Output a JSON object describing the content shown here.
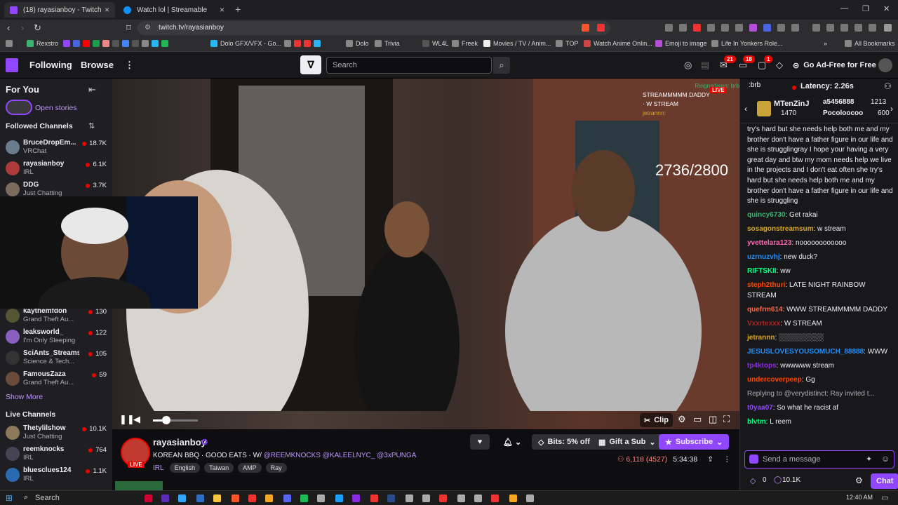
{
  "browser": {
    "tabs": [
      {
        "label": "(18) rayasianboy - Twitch",
        "active": true
      },
      {
        "label": "Watch lol | Streamable",
        "active": false
      }
    ],
    "url": "twitch.tv/rayasianboy",
    "bookmarks": [
      "Rexstro",
      "Dolo GFX/VFX - Go...",
      "Dolo",
      "Trivia",
      "WL4L",
      "Freek",
      "Movies / TV / Anim...",
      "TOP",
      "Watch Anime Onlin...",
      "Emoji to image",
      "Life In Yonkers Role..."
    ],
    "all_bookmarks": "All Bookmarks"
  },
  "twitch_top": {
    "following": "Following",
    "browse": "Browse",
    "search_placeholder": "Search",
    "badges": [
      "21",
      "18",
      "1"
    ],
    "adfree": "Go Ad-Free for Free"
  },
  "sidebar": {
    "for_you": "For You",
    "open_stories": "Open stories",
    "followed_header": "Followed Channels",
    "followed": [
      {
        "name": "BruceDropEm...",
        "category": "VRChat",
        "viewers": "18.7K"
      },
      {
        "name": "rayasianboy",
        "category": "IRL",
        "viewers": "6.1K"
      },
      {
        "name": "DDG",
        "category": "Just Chatting",
        "viewers": "3.7K"
      },
      {
        "name": "kaythemfdon",
        "category": "Grand Theft Au...",
        "viewers": "130"
      },
      {
        "name": "leaksworld_",
        "category": "I'm Only Sleeping",
        "viewers": "122"
      },
      {
        "name": "SciAnts_Streams",
        "category": "Science & Tech...",
        "viewers": "105"
      },
      {
        "name": "FamousZaza",
        "category": "Grand Theft Au...",
        "viewers": "59"
      }
    ],
    "show_more": "Show More",
    "live_header": "Live Channels",
    "live": [
      {
        "name": "Thetylilshow",
        "category": "Just Chatting",
        "viewers": "10.1K"
      },
      {
        "name": "reemknocks",
        "category": "IRL",
        "viewers": "764"
      },
      {
        "name": "bluesclues124",
        "category": "IRL",
        "viewers": "1.1K"
      }
    ]
  },
  "video": {
    "counter": "2736/2800",
    "clip": "Clip",
    "live": "LIVE",
    "seek_fraction": 0.2,
    "overlay_chat": [
      "STREAMMMMM DADDY",
      "· W STREAM",
      "jetrannn:",
      "Reignsdawg: brb"
    ]
  },
  "stream": {
    "channel": "rayasianboy",
    "live_label": "LIVE",
    "title_parts": [
      "KOREAN BBQ",
      "GOOD EATS",
      "W/",
      "@REEMKNOCKS @KALEELNYC_ @3xPUNGA"
    ],
    "category": "IRL",
    "tags": [
      "English",
      "Taiwan",
      "AMP",
      "Ray"
    ],
    "bits": "Bits: 5% off",
    "gift": "Gift a Sub",
    "subscribe": "Subscribe",
    "viewers": "6,118 (4527)",
    "uptime": "5:34:38"
  },
  "chat": {
    "latency": "Latency: 2.26s",
    "hype": [
      {
        "name": "MTenZinJ",
        "value": "1470"
      },
      {
        "name": "a5456888",
        "value": "1213"
      },
      {
        "name": "Pocoloocoo",
        "value": "600"
      }
    ],
    "messages": [
      {
        "user": "",
        "color": "#efeff1",
        "text": "try's hard but she needs help both me and my brother don't have a father figure in our life and she is strugglingray I hope your having a very great day and btw my mom needs help we live in the projects and I don't eat often she try's hard but she needs help both me and my brother don't have a father figure in our life and she is struggling"
      },
      {
        "user": "quincy6730",
        "color": "#3cb371",
        "text": "Get rakai"
      },
      {
        "user": "sosagonstreamsum",
        "color": "#daa520",
        "text": "w stream"
      },
      {
        "user": "yvettelara123",
        "color": "#ff69b4",
        "text": "noooooooooooo"
      },
      {
        "user": "uzrnuzvhj",
        "color": "#1e90ff",
        "text": "new duck?"
      },
      {
        "user": "RIFTSKII",
        "color": "#00ff7f",
        "text": "ww"
      },
      {
        "user": "steph2thuri",
        "color": "#ff4500",
        "text": "LATE NIGHT RAINBOW STREAM"
      },
      {
        "user": "quefrm614",
        "color": "#ff6347",
        "text": "WWW STREAMMMMM DADDY"
      },
      {
        "user": "Vxxrtexxx",
        "color": "#b22222",
        "text": "W STREAM"
      },
      {
        "user": "jetrannn",
        "color": "#daa520",
        "text": "░░░░░░░░░"
      },
      {
        "user": "JESUSLOVESYOUSOMUCH_88888",
        "color": "#1e90ff",
        "text": "WWW"
      },
      {
        "user": "tp4ktops",
        "color": "#8a2be2",
        "text": "wwwwww stream"
      },
      {
        "user": "undercoverpeep",
        "color": "#ff4500",
        "text": "Gg"
      },
      {
        "user": "",
        "color": "#adadb8",
        "text": "Replying to @verydistinct: Ray invited t..."
      },
      {
        "user": "t0yaa07",
        "color": "#9147ff",
        "text": "So what he racist af"
      },
      {
        "user": "blvtm",
        "color": "#00ff7f",
        "text": "L reem"
      }
    ],
    "input_placeholder": "Send a message",
    "points": "0",
    "channel_points": "10.1K",
    "chat_button": "Chat"
  },
  "taskbar": {
    "search": "Search",
    "time": "12:40 AM"
  }
}
